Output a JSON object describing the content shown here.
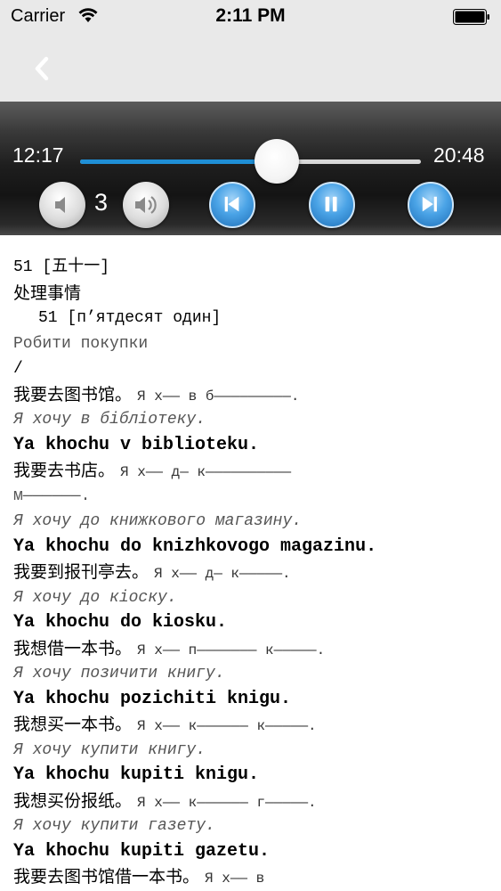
{
  "status_bar": {
    "carrier": "Carrier",
    "time": "2:11 PM",
    "wifi_icon": "wifi-icon",
    "battery_icon": "battery-icon"
  },
  "nav_bar": {
    "back_icon": "chevron-left-icon"
  },
  "player": {
    "current_time": "12:17",
    "total_time": "20:48",
    "progress": 0.578,
    "volume": "3",
    "accent_color": "#1f8fd6",
    "buttons": {
      "volume_down": "volume-down-icon",
      "volume_up": "volume-up-icon",
      "previous": "skip-previous-icon",
      "pause": "pause-icon",
      "next": "skip-next-icon"
    }
  },
  "lesson": {
    "lines": [
      {
        "type": "mono",
        "text": "51 [五十一]"
      },
      {
        "type": "zh-title",
        "text": "处理事情"
      },
      {
        "type": "mono-indent",
        "text": "51 [п’ятдесят один]"
      },
      {
        "type": "ua-plain",
        "text": "Робити покупки"
      },
      {
        "type": "mono",
        "text": "/"
      },
      {
        "type": "zh",
        "text": "我要去图书馆。",
        "hint": "Я х—— в б—————————."
      },
      {
        "type": "ua",
        "text": "Я хочу в бібліотеку."
      },
      {
        "type": "roman",
        "text": "Ya khochu v biblioteku."
      },
      {
        "type": "zh",
        "text": "我要去书店。",
        "hint": "Я х—— д— к——————————"
      },
      {
        "type": "ua-plain",
        "text": "м——————."
      },
      {
        "type": "ua",
        "text": "Я хочу до книжкового магазину."
      },
      {
        "type": "roman",
        "text": "Ya khochu do knizhkovogo magazinu."
      },
      {
        "type": "zh",
        "text": "我要到报刊亭去。",
        "hint": "Я х—— д— к—————."
      },
      {
        "type": "ua",
        "text": "Я хочу до кіоску."
      },
      {
        "type": "roman",
        "text": "Ya khochu do kiosku."
      },
      {
        "type": "zh",
        "text": "我想借一本书。",
        "hint": "Я х—— п——————— к—————."
      },
      {
        "type": "ua",
        "text": "Я хочу позичити книгу."
      },
      {
        "type": "roman",
        "text": "Ya khochu pozichiti knigu."
      },
      {
        "type": "zh",
        "text": "我想买一本书。",
        "hint": "Я х—— к—————— к—————."
      },
      {
        "type": "ua",
        "text": "Я хочу купити книгу."
      },
      {
        "type": "roman",
        "text": "Ya khochu kupiti knigu."
      },
      {
        "type": "zh",
        "text": "我想买份报纸。",
        "hint": "Я х—— к—————— г—————."
      },
      {
        "type": "ua",
        "text": "Я хочу купити газету."
      },
      {
        "type": "roman",
        "text": "Ya khochu kupiti gazetu."
      },
      {
        "type": "zh",
        "text": "我要去图书馆借一本书。",
        "hint": "Я х—— в"
      }
    ]
  }
}
